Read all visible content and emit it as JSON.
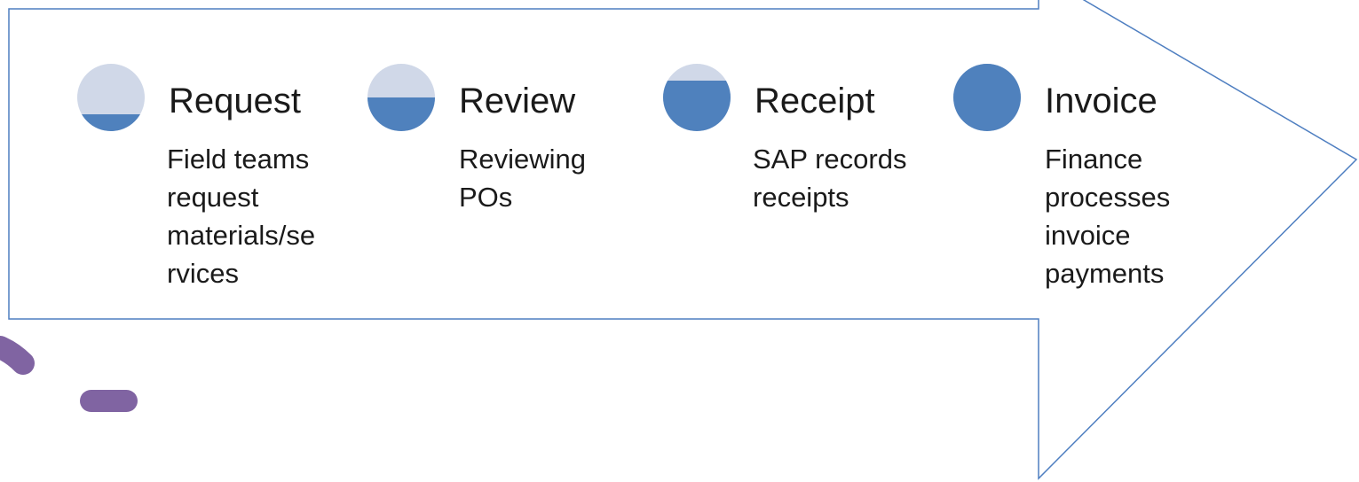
{
  "colors": {
    "arrow_stroke": "#4f7fc1",
    "arrow_fill": "#ffffff",
    "circle_empty": "#d0d8e8",
    "circle_fill": "#4f81bd",
    "decoration": "#8064a2",
    "text": "#1a1a1a"
  },
  "steps": [
    {
      "title": "Request",
      "desc_lines": [
        "Field teams",
        "request",
        "materials/se",
        "rvices"
      ],
      "fill_level": 0.25
    },
    {
      "title": "Review",
      "desc_lines": [
        "Reviewing",
        "POs"
      ],
      "fill_level": 0.5
    },
    {
      "title": "Receipt",
      "desc_lines": [
        "SAP records",
        "receipts"
      ],
      "fill_level": 0.75
    },
    {
      "title": "Invoice",
      "desc_lines": [
        "Finance",
        "processes",
        "invoice",
        "payments"
      ],
      "fill_level": 1.0
    }
  ]
}
